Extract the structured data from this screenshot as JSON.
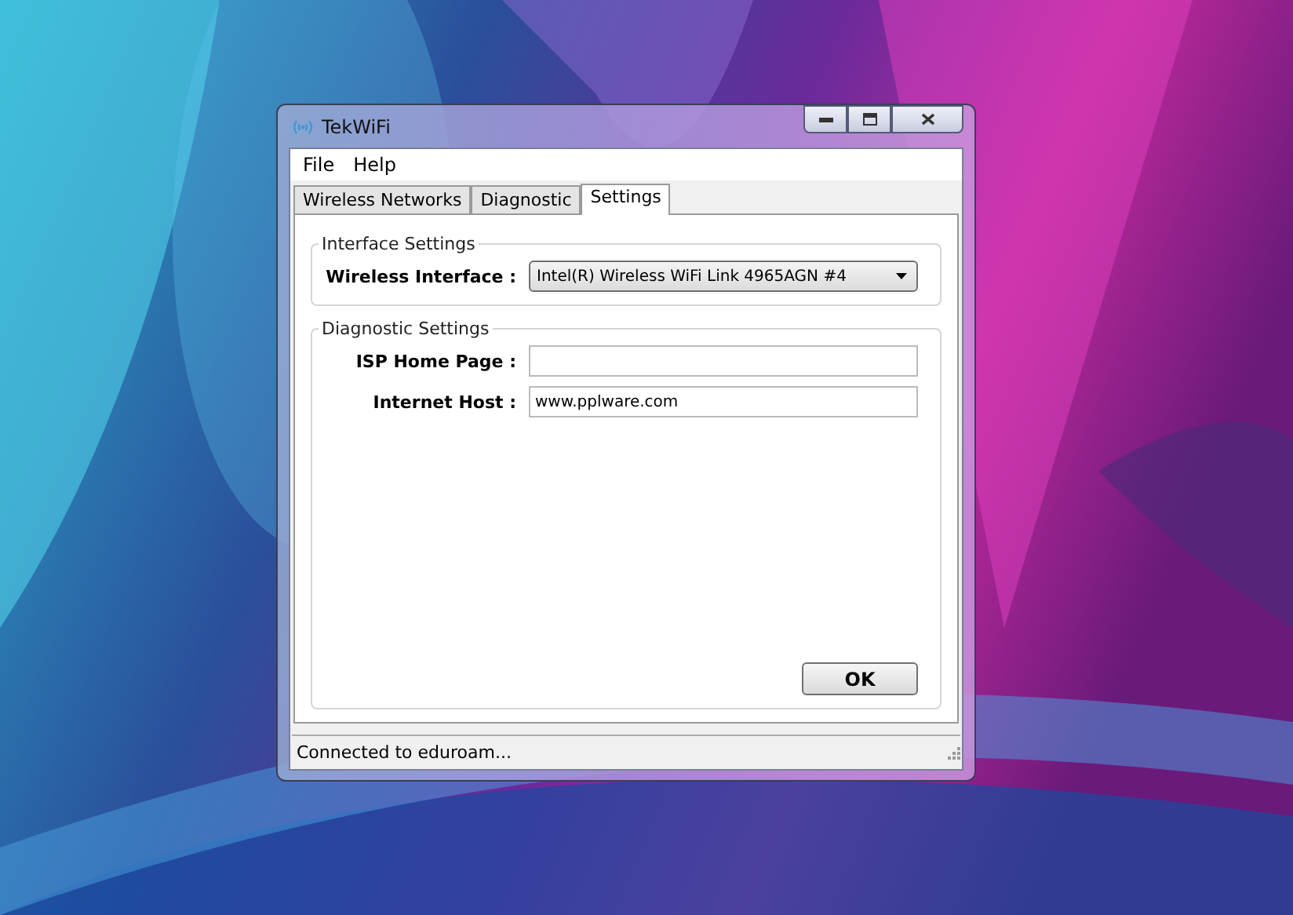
{
  "window": {
    "title": "TekWiFi"
  },
  "menu": [
    "File",
    "Help"
  ],
  "tabs": [
    {
      "label": "Wireless Networks",
      "selected": false
    },
    {
      "label": "Diagnostic",
      "selected": false
    },
    {
      "label": "Settings",
      "selected": true
    }
  ],
  "groups": [
    {
      "title": "Interface Settings",
      "fields": [
        {
          "kind": "dropdown",
          "label": "Wireless Interface :",
          "value": "Intel(R) Wireless WiFi Link 4965AGN #4"
        }
      ]
    },
    {
      "title": "Diagnostic Settings",
      "fields": [
        {
          "kind": "text",
          "label": "ISP Home Page :"
        },
        {
          "kind": "text",
          "label": "Internet Host :",
          "value": "www.pplware.com"
        }
      ]
    }
  ],
  "ok_button": "OK",
  "status_bar": "Connected to eduroam..."
}
